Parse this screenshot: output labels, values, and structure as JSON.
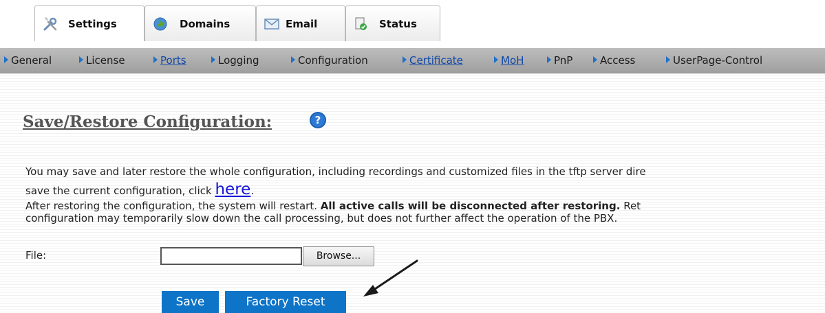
{
  "tabs": [
    {
      "label": "Settings",
      "icon": "wrench-screwdriver-icon",
      "active": true
    },
    {
      "label": "Domains",
      "icon": "globe-icon",
      "active": false
    },
    {
      "label": "Email",
      "icon": "envelope-icon",
      "active": false
    },
    {
      "label": "Status",
      "icon": "status-page-icon",
      "active": false
    }
  ],
  "subnav": [
    {
      "label": "General"
    },
    {
      "label": "License"
    },
    {
      "label": "Ports",
      "underlined": true
    },
    {
      "label": "Logging"
    },
    {
      "label": "Configuration"
    },
    {
      "label": "Certificate",
      "underlined": true
    },
    {
      "label": "MoH",
      "underlined": true
    },
    {
      "label": "PnP"
    },
    {
      "label": "Access"
    },
    {
      "label": "UserPage-Control"
    }
  ],
  "page": {
    "title": "Save/Restore Configuration:",
    "help_icon_glyph": "?",
    "para1_line1": "You may save and later restore the whole configuration, including recordings and customized files in the tftp server dire",
    "para1_line2_prefix": "save the current configuration, click ",
    "here_link": "here",
    "para1_line2_suffix": ".",
    "para2_line1_prefix": "After restoring the configuration, the system will restart. ",
    "para2_line1_bold": "All active calls will be disconnected after restoring.",
    "para2_line1_suffix": " Ret",
    "para2_line2": "configuration may temporarily slow down the call processing, but does not further affect the operation of the PBX."
  },
  "form": {
    "file_label": "File:",
    "file_value": "",
    "browse_label": "Browse...",
    "save_label": "Save",
    "factory_reset_label": "Factory Reset"
  },
  "colors": {
    "accent_button": "#0e74c7",
    "link": "#1414d6",
    "nav_triangle": "#1f70c8",
    "annotation_arrow": "#1a1a1a"
  }
}
